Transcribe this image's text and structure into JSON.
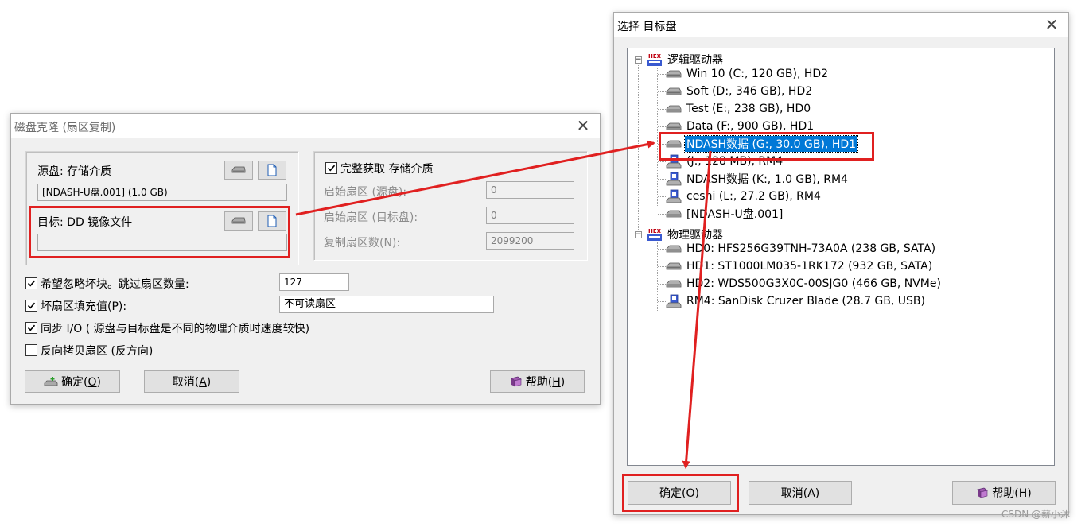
{
  "clone": {
    "title": "磁盘克隆 (扇区复制)",
    "source_label": "源盘: 存储介质",
    "source_value": "[NDASH-U盘.001] (1.0 GB)",
    "target_label": "目标: DD 镜像文件",
    "target_value": "",
    "full_capture_label": "完整获取 存储介质",
    "start_src_label": "启始扇区 (源盘):",
    "start_src_value": "0",
    "start_tgt_label": "启始扇区 (目标盘):",
    "start_tgt_value": "0",
    "copy_count_label": "复制扇区数(N):",
    "copy_count_value": "2099200",
    "ignore_bad_label": "希望忽略坏块。跳过扇区数量:",
    "ignore_bad_value": "127",
    "fill_bad_label": "坏扇区填充值(P):",
    "fill_bad_value": "不可读扇区",
    "sync_io_label": "同步 I/O ( 源盘与目标盘是不同的物理介质时速度较快)",
    "reverse_label": "反向拷贝扇区 (反方向)",
    "ok_text": "确定(",
    "ok_key": "O",
    "cancel_text": "取消(",
    "cancel_key": "A",
    "help_text": "帮助(",
    "help_key": "H",
    "close_paren": ")",
    "checks": {
      "full_capture": true,
      "ignore_bad": true,
      "fill_bad": true,
      "sync_io": true,
      "reverse": false
    }
  },
  "select": {
    "title": "选择 目标盘",
    "logical_group": "逻辑驱动器",
    "logical_items": [
      "Win 10 (C:, 120 GB), HD2",
      "Soft (D:, 346 GB), HD2",
      "Test (E:, 238 GB), HD0",
      "Data (F:, 900 GB), HD1",
      "NDASH数据 (G:, 30.0 GB), HD1",
      "(J:, 128 MB), RM4",
      "NDASH数据 (K:, 1.0 GB), RM4",
      "ceshi  (L:, 27.2 GB), RM4",
      "[NDASH-U盘.001]"
    ],
    "physical_group": "物理驱动器",
    "physical_items": [
      "HD0: HFS256G39TNH-73A0A (238 GB, SATA)",
      "HD1: ST1000LM035-1RK172 (932 GB, SATA)",
      "HD2: WDS500G3X0C-00SJG0 (466 GB, NVMe)",
      "RM4: SanDisk Cruzer Blade (28.7 GB, USB)"
    ],
    "ok_text": "确定(",
    "ok_key": "O",
    "cancel_text": "取消(",
    "cancel_key": "A",
    "help_text": "帮助(",
    "help_key": "H",
    "close_paren": ")"
  },
  "hex_badge": "HEX",
  "watermark": "CSDN @薪小沐",
  "colors": {
    "annotation": "#e02020",
    "selection": "#0078d7"
  }
}
